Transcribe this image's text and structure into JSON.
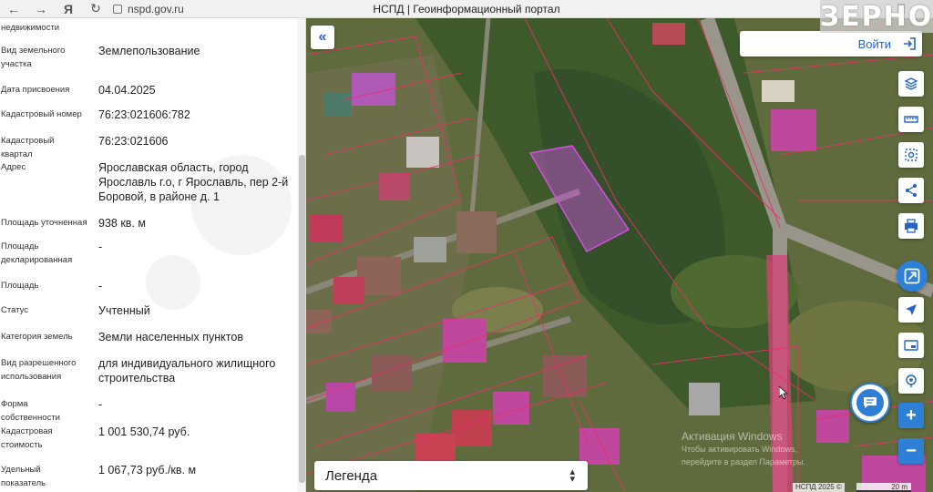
{
  "browser": {
    "url": "nspd.gov.ru",
    "title": "НСПД | Геоинформационный портал"
  },
  "brand_logo": "ЗЕРНО",
  "panel": {
    "top_cut_label": "недвижимости",
    "rows": [
      {
        "label": "Вид земельного участка",
        "value": "Землепользование"
      },
      {
        "label": "Дата присвоения",
        "value": "04.04.2025"
      },
      {
        "label": "Кадастровый номер",
        "value": "76:23:021606:782"
      },
      {
        "label": "Кадастровый квартал",
        "value": "76:23:021606"
      },
      {
        "label": "Адрес",
        "value": "Ярославская область, город Ярославль г.о, г Ярославль, пер 2-й Боровой, в районе д. 1"
      },
      {
        "label": "Площадь уточненная",
        "value": "938 кв. м"
      },
      {
        "label": "Площадь декларированная",
        "value": "-"
      },
      {
        "label": "Площадь",
        "value": "-"
      },
      {
        "label": "Статус",
        "value": "Учтенный"
      },
      {
        "label": "Категория земель",
        "value": "Земли населенных пунктов"
      },
      {
        "label": "Вид разрешенного использования",
        "value": "для индивидуального жилищного строительства"
      },
      {
        "label": "Форма собственности",
        "value": "-"
      },
      {
        "label": "Кадастровая стоимость",
        "value": "1 001 530,74 руб."
      },
      {
        "label": "Удельный показатель кадастровой",
        "value": "1 067,73 руб./кв. м"
      }
    ]
  },
  "map": {
    "login_label": "Войти",
    "legend_label": "Легенда",
    "activation_title": "Активация Windows",
    "activation_sub": "Чтобы активировать Windows, перейдите в раздел Параметры.",
    "attribution": "НСПД 2025 ©",
    "scale_label": "20 m",
    "tools": [
      "layers-icon",
      "ruler-icon",
      "select-area-icon",
      "share-icon",
      "print-icon",
      "nspd-tool-icon",
      "navigate-icon",
      "screen-icon",
      "locate-icon"
    ],
    "zoom_in": "+",
    "zoom_out": "−"
  },
  "colors": {
    "accent": "#2e7fd6",
    "parcel_highlight": "#c04fd0",
    "parcel_border": "#e0306a"
  }
}
